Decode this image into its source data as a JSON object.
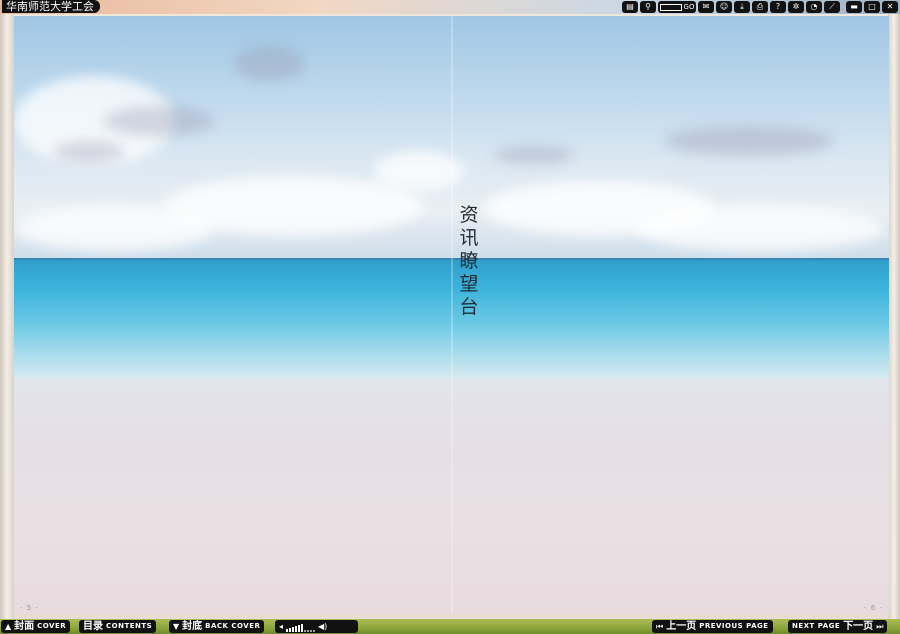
{
  "window": {
    "title": "华南师范大学工会"
  },
  "toolbar": {
    "buttons": [
      {
        "name": "thumbnails-icon",
        "glyph": "▤"
      },
      {
        "name": "zoom-icon",
        "glyph": "⚲"
      },
      {
        "name": "page-input",
        "glyph": "GO"
      },
      {
        "name": "comment-icon",
        "glyph": "✉"
      },
      {
        "name": "user-icon",
        "glyph": "☺"
      },
      {
        "name": "download-icon",
        "glyph": "⤓"
      },
      {
        "name": "print-icon",
        "glyph": "⎙"
      },
      {
        "name": "help-icon",
        "glyph": "?"
      },
      {
        "name": "settings-icon",
        "glyph": "✲"
      },
      {
        "name": "clock-icon",
        "glyph": "◔"
      },
      {
        "name": "share-icon",
        "glyph": "⟋"
      },
      {
        "name": "minimize-icon",
        "glyph": "▬"
      },
      {
        "name": "maximize-icon",
        "glyph": "□"
      },
      {
        "name": "close-icon",
        "glyph": "✕"
      }
    ]
  },
  "page": {
    "headline": "资讯瞭望台",
    "left_page_number": "- 5 -",
    "right_page_number": "- 6 -"
  },
  "bottom": {
    "cover_zh": "封面",
    "cover_en": "COVER",
    "contents_zh": "目录",
    "contents_en": "CONTENTS",
    "back_zh": "封底",
    "back_en": "BACK COVER",
    "prev_zh": "上一页",
    "prev_en": "PREVIOUS PAGE",
    "next_en": "NEXT PAGE",
    "next_zh": "下一页",
    "volume_level": 0.6
  },
  "colors": {
    "bar_bg": "#111111",
    "sea": "#3bb3dc",
    "sky": "#bcd7ec"
  }
}
